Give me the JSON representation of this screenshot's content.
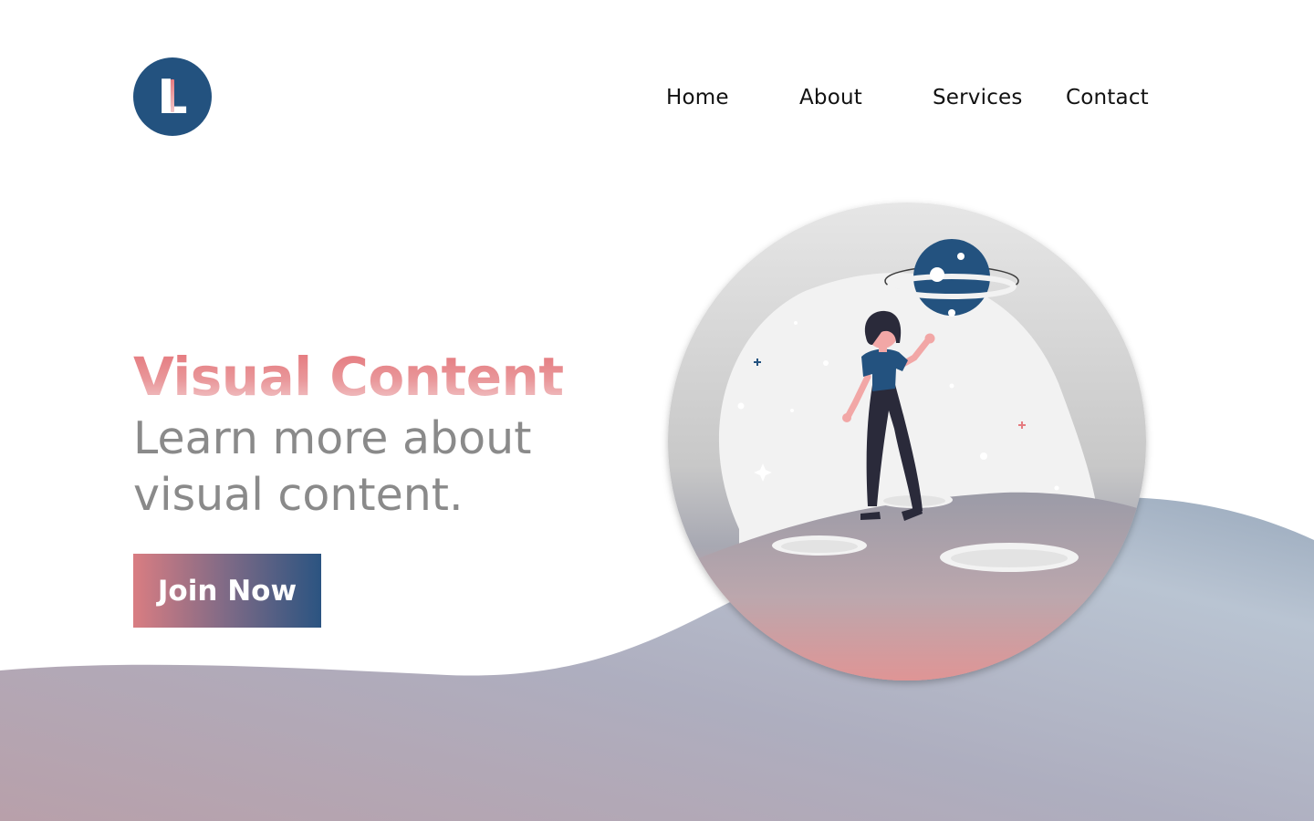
{
  "brand": {
    "logo_letter": "L",
    "primary_color": "#23527f",
    "accent_color": "#e47479"
  },
  "nav": {
    "items": [
      {
        "label": "Home"
      },
      {
        "label": "About"
      },
      {
        "label": "Services"
      },
      {
        "label": "Contact"
      }
    ]
  },
  "hero": {
    "title": "Visual Content",
    "subtitle_line1": "Learn more about",
    "subtitle_line2": "visual content.",
    "cta_label": "Join Now"
  },
  "illustration": {
    "icon": "woman-reaching-planet-illustration"
  }
}
